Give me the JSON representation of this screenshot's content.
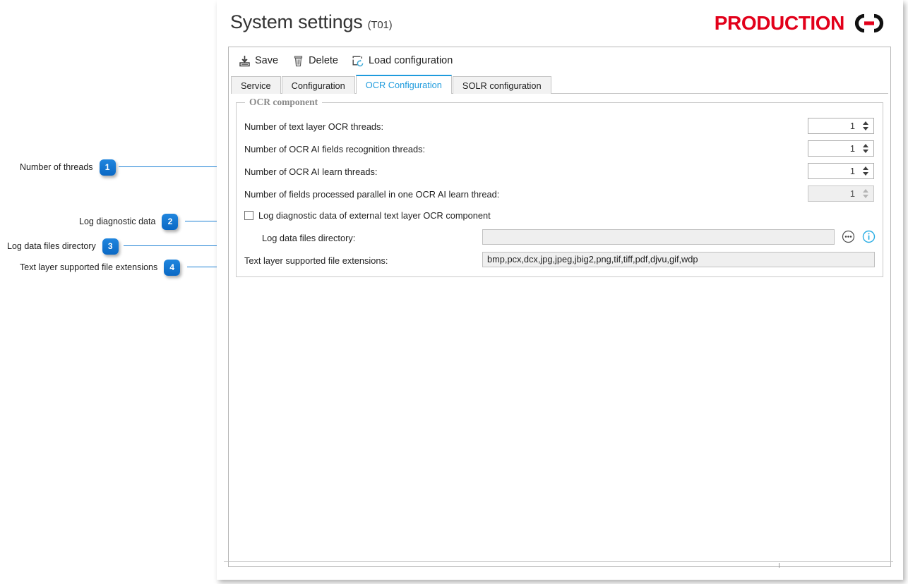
{
  "window": {
    "title": "System settings",
    "title_suffix": "(T01)",
    "brand": {
      "text": "PRODUCTION",
      "color": "#e2001a",
      "mark_icon": "chain-link-icon"
    }
  },
  "toolbar": {
    "buttons": [
      {
        "label": "Save",
        "icon": "save-icon"
      },
      {
        "label": "Delete",
        "icon": "trash-icon"
      },
      {
        "label": "Load configuration",
        "icon": "load-configuration-icon"
      }
    ]
  },
  "tabs": [
    {
      "label": "Service",
      "active": false
    },
    {
      "label": "Configuration",
      "active": false
    },
    {
      "label": "OCR Configuration",
      "active": true
    },
    {
      "label": "SOLR configuration",
      "active": false
    }
  ],
  "group": {
    "legend": "OCR component",
    "fields": [
      {
        "label": "Number of text layer OCR threads:",
        "value": "1",
        "disabled": false
      },
      {
        "label": "Number of OCR AI fields recognition threads:",
        "value": "1",
        "disabled": false
      },
      {
        "label": "Number of OCR AI learn threads:",
        "value": "1",
        "disabled": false
      },
      {
        "label": "Number of fields processed parallel in one OCR AI learn thread:",
        "value": "1",
        "disabled": true
      }
    ],
    "checkbox": {
      "label": "Log diagnostic data of external text layer OCR component",
      "checked": false
    },
    "log_dir": {
      "label": "Log data files directory:",
      "value": "",
      "placeholder": "",
      "browse_icon": "ellipsis-icon",
      "info_icon": "info-icon",
      "info_icon_color": "#29ade4"
    },
    "extensions": {
      "label": "Text layer supported file extensions:",
      "value": "bmp,pcx,dcx,jpg,jpeg,jbig2,png,tif,tiff,pdf,djvu,gif,wdp"
    }
  },
  "callouts": [
    {
      "number": "1",
      "label": "Number of threads"
    },
    {
      "number": "2",
      "label": "Log diagnostic data"
    },
    {
      "number": "3",
      "label": "Log data files directory"
    },
    {
      "number": "4",
      "label": "Text layer supported file extensions"
    }
  ]
}
